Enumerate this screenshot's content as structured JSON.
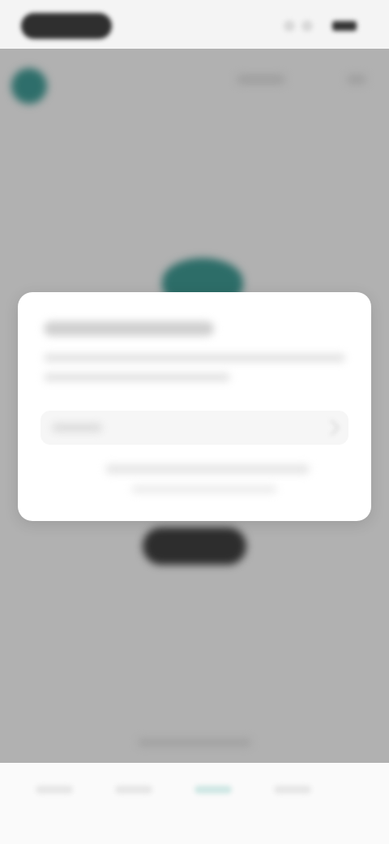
{
  "colors": {
    "accent": "#3a8c86",
    "button_dark": "#3a3a3a",
    "status_pill": "#2f2f2f"
  },
  "icons": {
    "avatar": "account-avatar-icon",
    "logo": "app-logo-icon",
    "chevron": "chevron-right-icon"
  }
}
